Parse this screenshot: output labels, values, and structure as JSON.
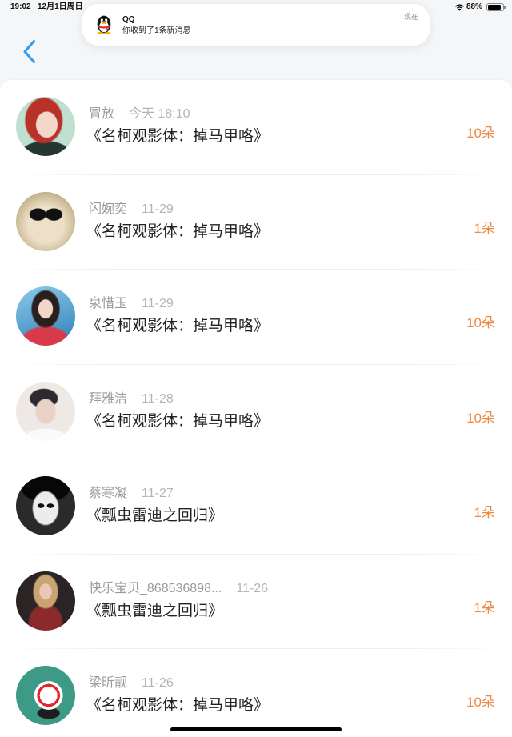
{
  "status_bar": {
    "time": "19:02",
    "date": "12月1日周日",
    "battery_percent": "88%",
    "wifi_icon": "wifi-icon",
    "battery_icon": "battery-icon"
  },
  "notification": {
    "icon": "qq-penguin-icon",
    "app_name": "QQ",
    "message": "你收到了1条新消息",
    "time": "现在"
  },
  "header": {
    "back_icon": "chevron-left-icon"
  },
  "colors": {
    "accent": "#2f9cf1",
    "count": "#ec8a45",
    "name": "#9b9b9b",
    "date": "#b4b4b4",
    "title": "#222222"
  },
  "items": [
    {
      "name": "冒放",
      "date": "今天 18:10",
      "title": "《名柯观影体：掉马甲咯》",
      "count": "10朵"
    },
    {
      "name": "闪婉奕",
      "date": "11-29",
      "title": "《名柯观影体：掉马甲咯》",
      "count": "1朵"
    },
    {
      "name": "泉惜玉",
      "date": "11-29",
      "title": "《名柯观影体：掉马甲咯》",
      "count": "10朵"
    },
    {
      "name": "拜雅洁",
      "date": "11-28",
      "title": "《名柯观影体：掉马甲咯》",
      "count": "10朵"
    },
    {
      "name": "蔡寒凝",
      "date": "11-27",
      "title": "《瓢虫雷迪之回归》",
      "count": "1朵"
    },
    {
      "name": "快乐宝贝_868536898...",
      "date": "11-26",
      "title": "《瓢虫雷迪之回归》",
      "count": "1朵"
    },
    {
      "name": "梁昕靓",
      "date": "11-26",
      "title": "《名柯观影体：掉马甲咯》",
      "count": "10朵"
    }
  ]
}
